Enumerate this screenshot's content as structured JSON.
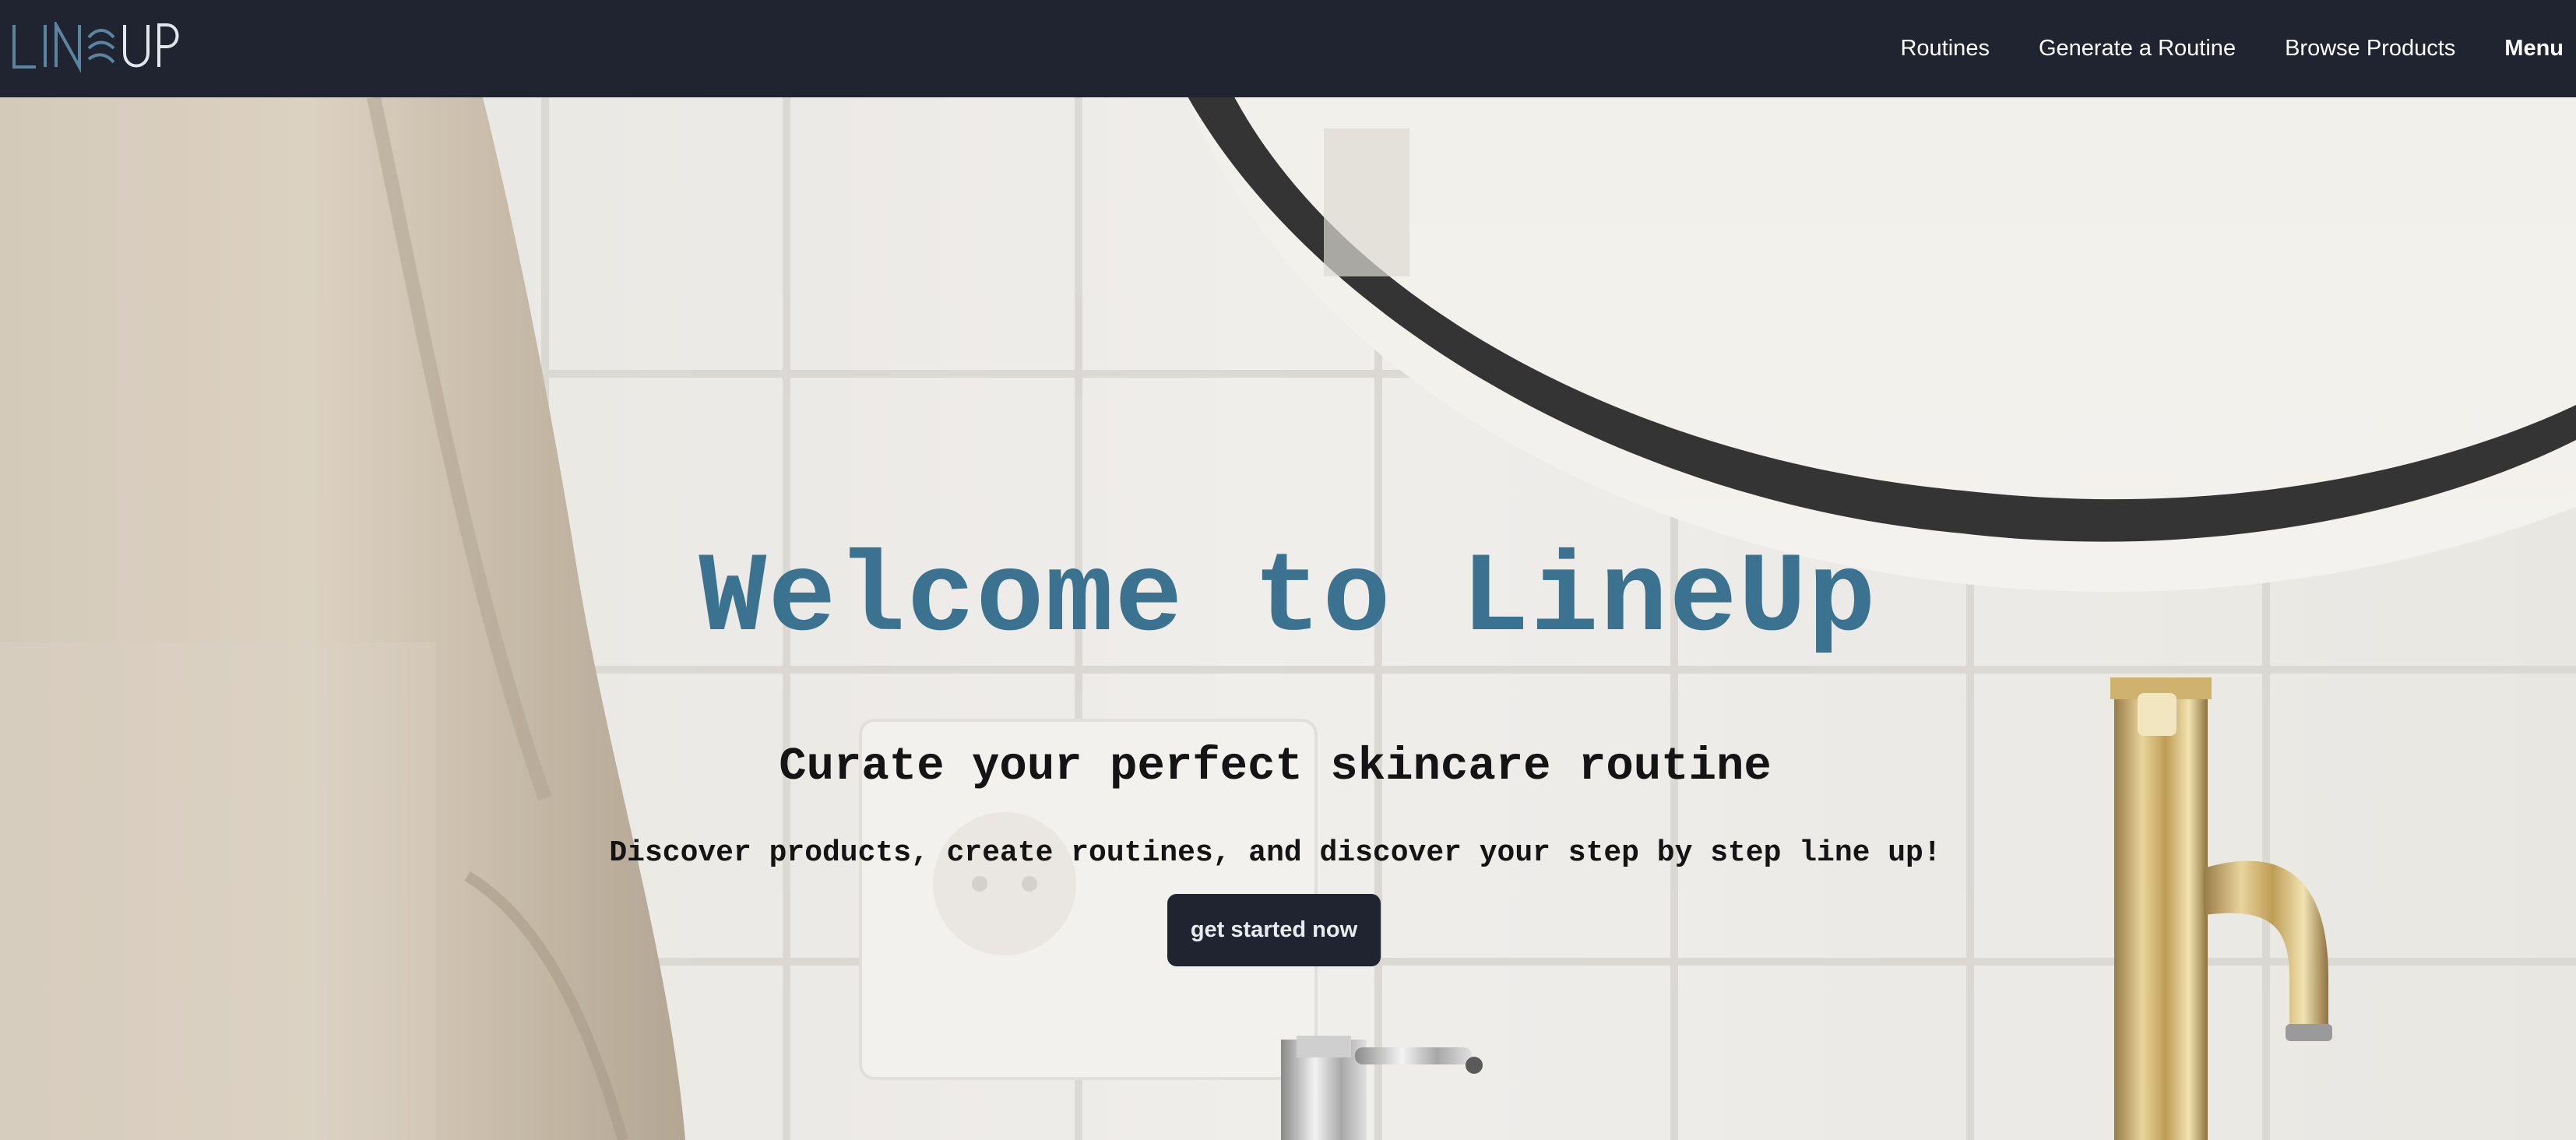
{
  "nav": {
    "logo_text": "LINEUP",
    "links": [
      "Routines",
      "Generate a Routine",
      "Browse Products"
    ],
    "menu_label": "Menu"
  },
  "hero": {
    "title": "Welcome to LineUp",
    "subtitle": "Curate your perfect skincare routine",
    "description": "Discover products, create routines, and discover your step by step line up!",
    "cta_label": "get started now"
  },
  "colors": {
    "nav_bg": "#1f2430",
    "title": "#3a7290",
    "logo_accent": "#4d7e9b",
    "text_dark": "#141414"
  }
}
